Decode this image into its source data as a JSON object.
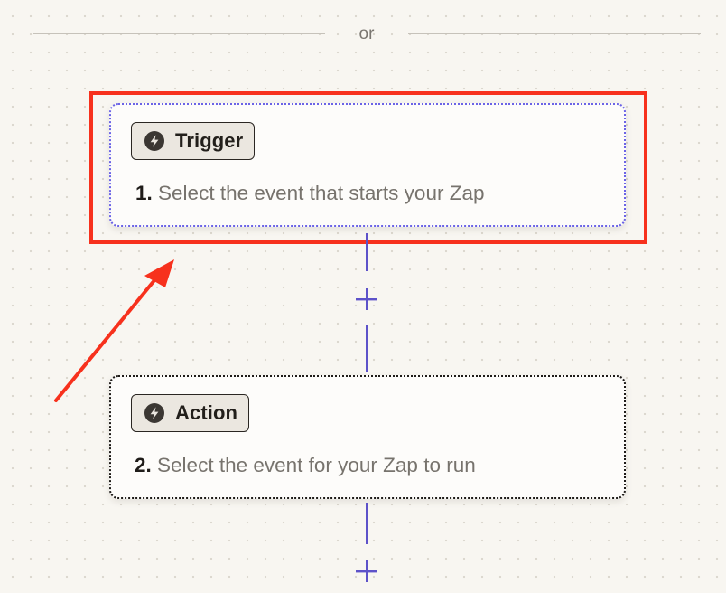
{
  "divider": {
    "text": "or"
  },
  "trigger_step": {
    "chip_label": "Trigger",
    "chip_icon": "lightning-bolt-icon",
    "number": "1.",
    "description": "Select the event that starts your Zap"
  },
  "action_step": {
    "chip_label": "Action",
    "chip_icon": "lightning-bolt-icon",
    "number": "2.",
    "description": "Select the event for your Zap to run"
  },
  "colors": {
    "canvas_background": "#f8f6f1",
    "accent_purple": "#5d52c9",
    "selected_border": "#6b63e6",
    "annotation_red": "#f7311d"
  }
}
